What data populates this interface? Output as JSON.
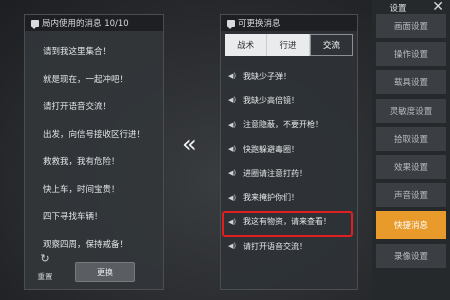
{
  "left_panel": {
    "header": "局内使用的消息 10/10",
    "items": [
      "请到我这里集合！",
      "就是现在，一起冲吧！",
      "请打开语音交流！",
      "出发，向信号接收区行进！",
      "救救我，我有危险！",
      "快上车，时间宝贵！",
      "四下寻找车辆！",
      "观察四周，保持戒备！"
    ],
    "reset_label": "重置",
    "change_label": "更换"
  },
  "arrow": "«",
  "mid_panel": {
    "header": "可更换消息",
    "tabs": [
      "战术",
      "行进",
      "交流"
    ],
    "active_tab": 2,
    "items": [
      "我缺少子弹！",
      "我缺少高倍镜！",
      "注意隐蔽，不要开枪！",
      "快跑躲避毒圈！",
      "进圈请注意打药！",
      "我来掩护你们！",
      "我这有物资，请来查看！",
      "请打开语音交流！"
    ],
    "highlighted_index": 6
  },
  "settings": {
    "title": "设置",
    "items": [
      "画面设置",
      "操作设置",
      "载具设置",
      "灵敏度设置",
      "拾取设置",
      "效果设置",
      "声音设置",
      "快捷消息",
      "录像设置"
    ],
    "active_index": 7
  },
  "colors": {
    "accent": "#e89a2a",
    "highlight_border": "#e02020"
  }
}
